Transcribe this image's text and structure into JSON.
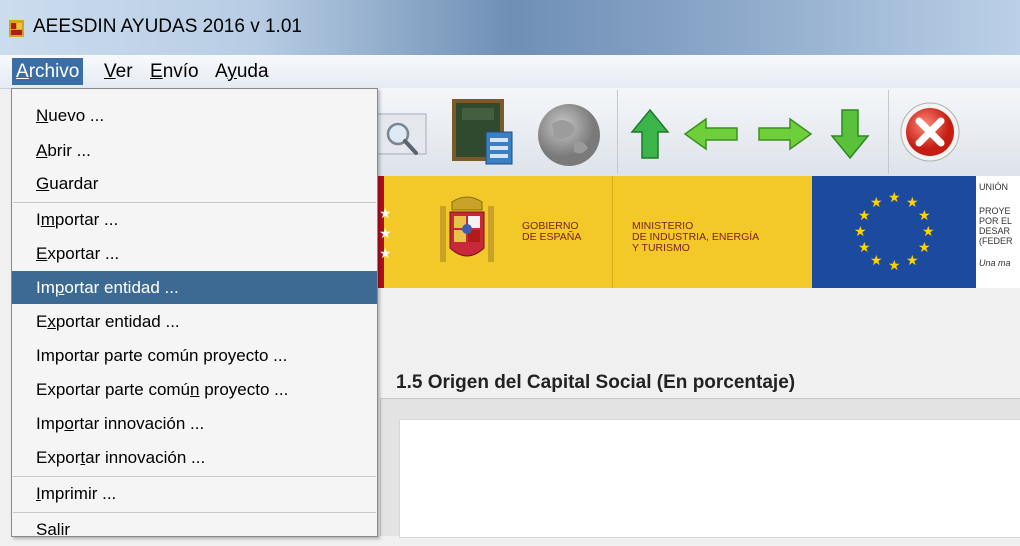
{
  "window": {
    "title": "AEESDIN AYUDAS 2016  v 1.01"
  },
  "menubar": {
    "items": [
      {
        "pre": "",
        "key": "A",
        "post": "rchivo"
      },
      {
        "pre": "",
        "key": "V",
        "post": "er"
      },
      {
        "pre": "",
        "key": "E",
        "post": "nvío"
      },
      {
        "pre": "A",
        "key": "y",
        "post": "uda"
      }
    ]
  },
  "file_menu": {
    "items": [
      {
        "pre": "",
        "key": "N",
        "post": "uevo ..."
      },
      {
        "pre": "",
        "key": "A",
        "post": "brir ..."
      },
      {
        "pre": "",
        "key": "G",
        "post": "uardar"
      },
      {
        "pre": "I",
        "key": "m",
        "post": "portar ..."
      },
      {
        "pre": "",
        "key": "E",
        "post": "xportar ..."
      },
      {
        "pre": "Im",
        "key": "p",
        "post": "ortar entidad ..."
      },
      {
        "pre": "E",
        "key": "x",
        "post": "portar entidad ..."
      },
      {
        "pre": "Importar parte común proyecto ...",
        "key": "",
        "post": ""
      },
      {
        "pre": "Exportar parte comú",
        "key": "n",
        "post": " proyecto ..."
      },
      {
        "pre": "Imp",
        "key": "o",
        "post": "rtar innovación ..."
      },
      {
        "pre": "Expor",
        "key": "t",
        "post": "ar innovación ..."
      },
      {
        "pre": "",
        "key": "I",
        "post": "mprimir ..."
      },
      {
        "pre": "Salir",
        "key": "",
        "post": ""
      }
    ],
    "highlighted_index": 5
  },
  "toolbar": {
    "icons": [
      "search-icon",
      "calculator-book-icon",
      "globe-icon",
      "arrow-up-icon",
      "arrow-left-icon",
      "arrow-right-icon",
      "arrow-down-icon",
      "close-icon"
    ]
  },
  "banner": {
    "gov_line1": "GOBIERNO",
    "gov_line2": "DE ESPAÑA",
    "min_line1": "MINISTERIO",
    "min_line2": "DE INDUSTRIA, ENERGÍA",
    "min_line3": "Y TURISMO",
    "eu_line1": "UNIÓN",
    "eu_line2": "PROYE",
    "eu_line3": "POR EL",
    "eu_line4": "DESAR",
    "eu_line5": "(FEDER",
    "eu_line6": "Una ma",
    "colors": {
      "yellow": "#f3c92a",
      "red": "#b30f1e",
      "eu_blue": "#1c4a9e"
    }
  },
  "main": {
    "section_title": "1.5 Origen del Capital Social (En porcentaje)"
  }
}
